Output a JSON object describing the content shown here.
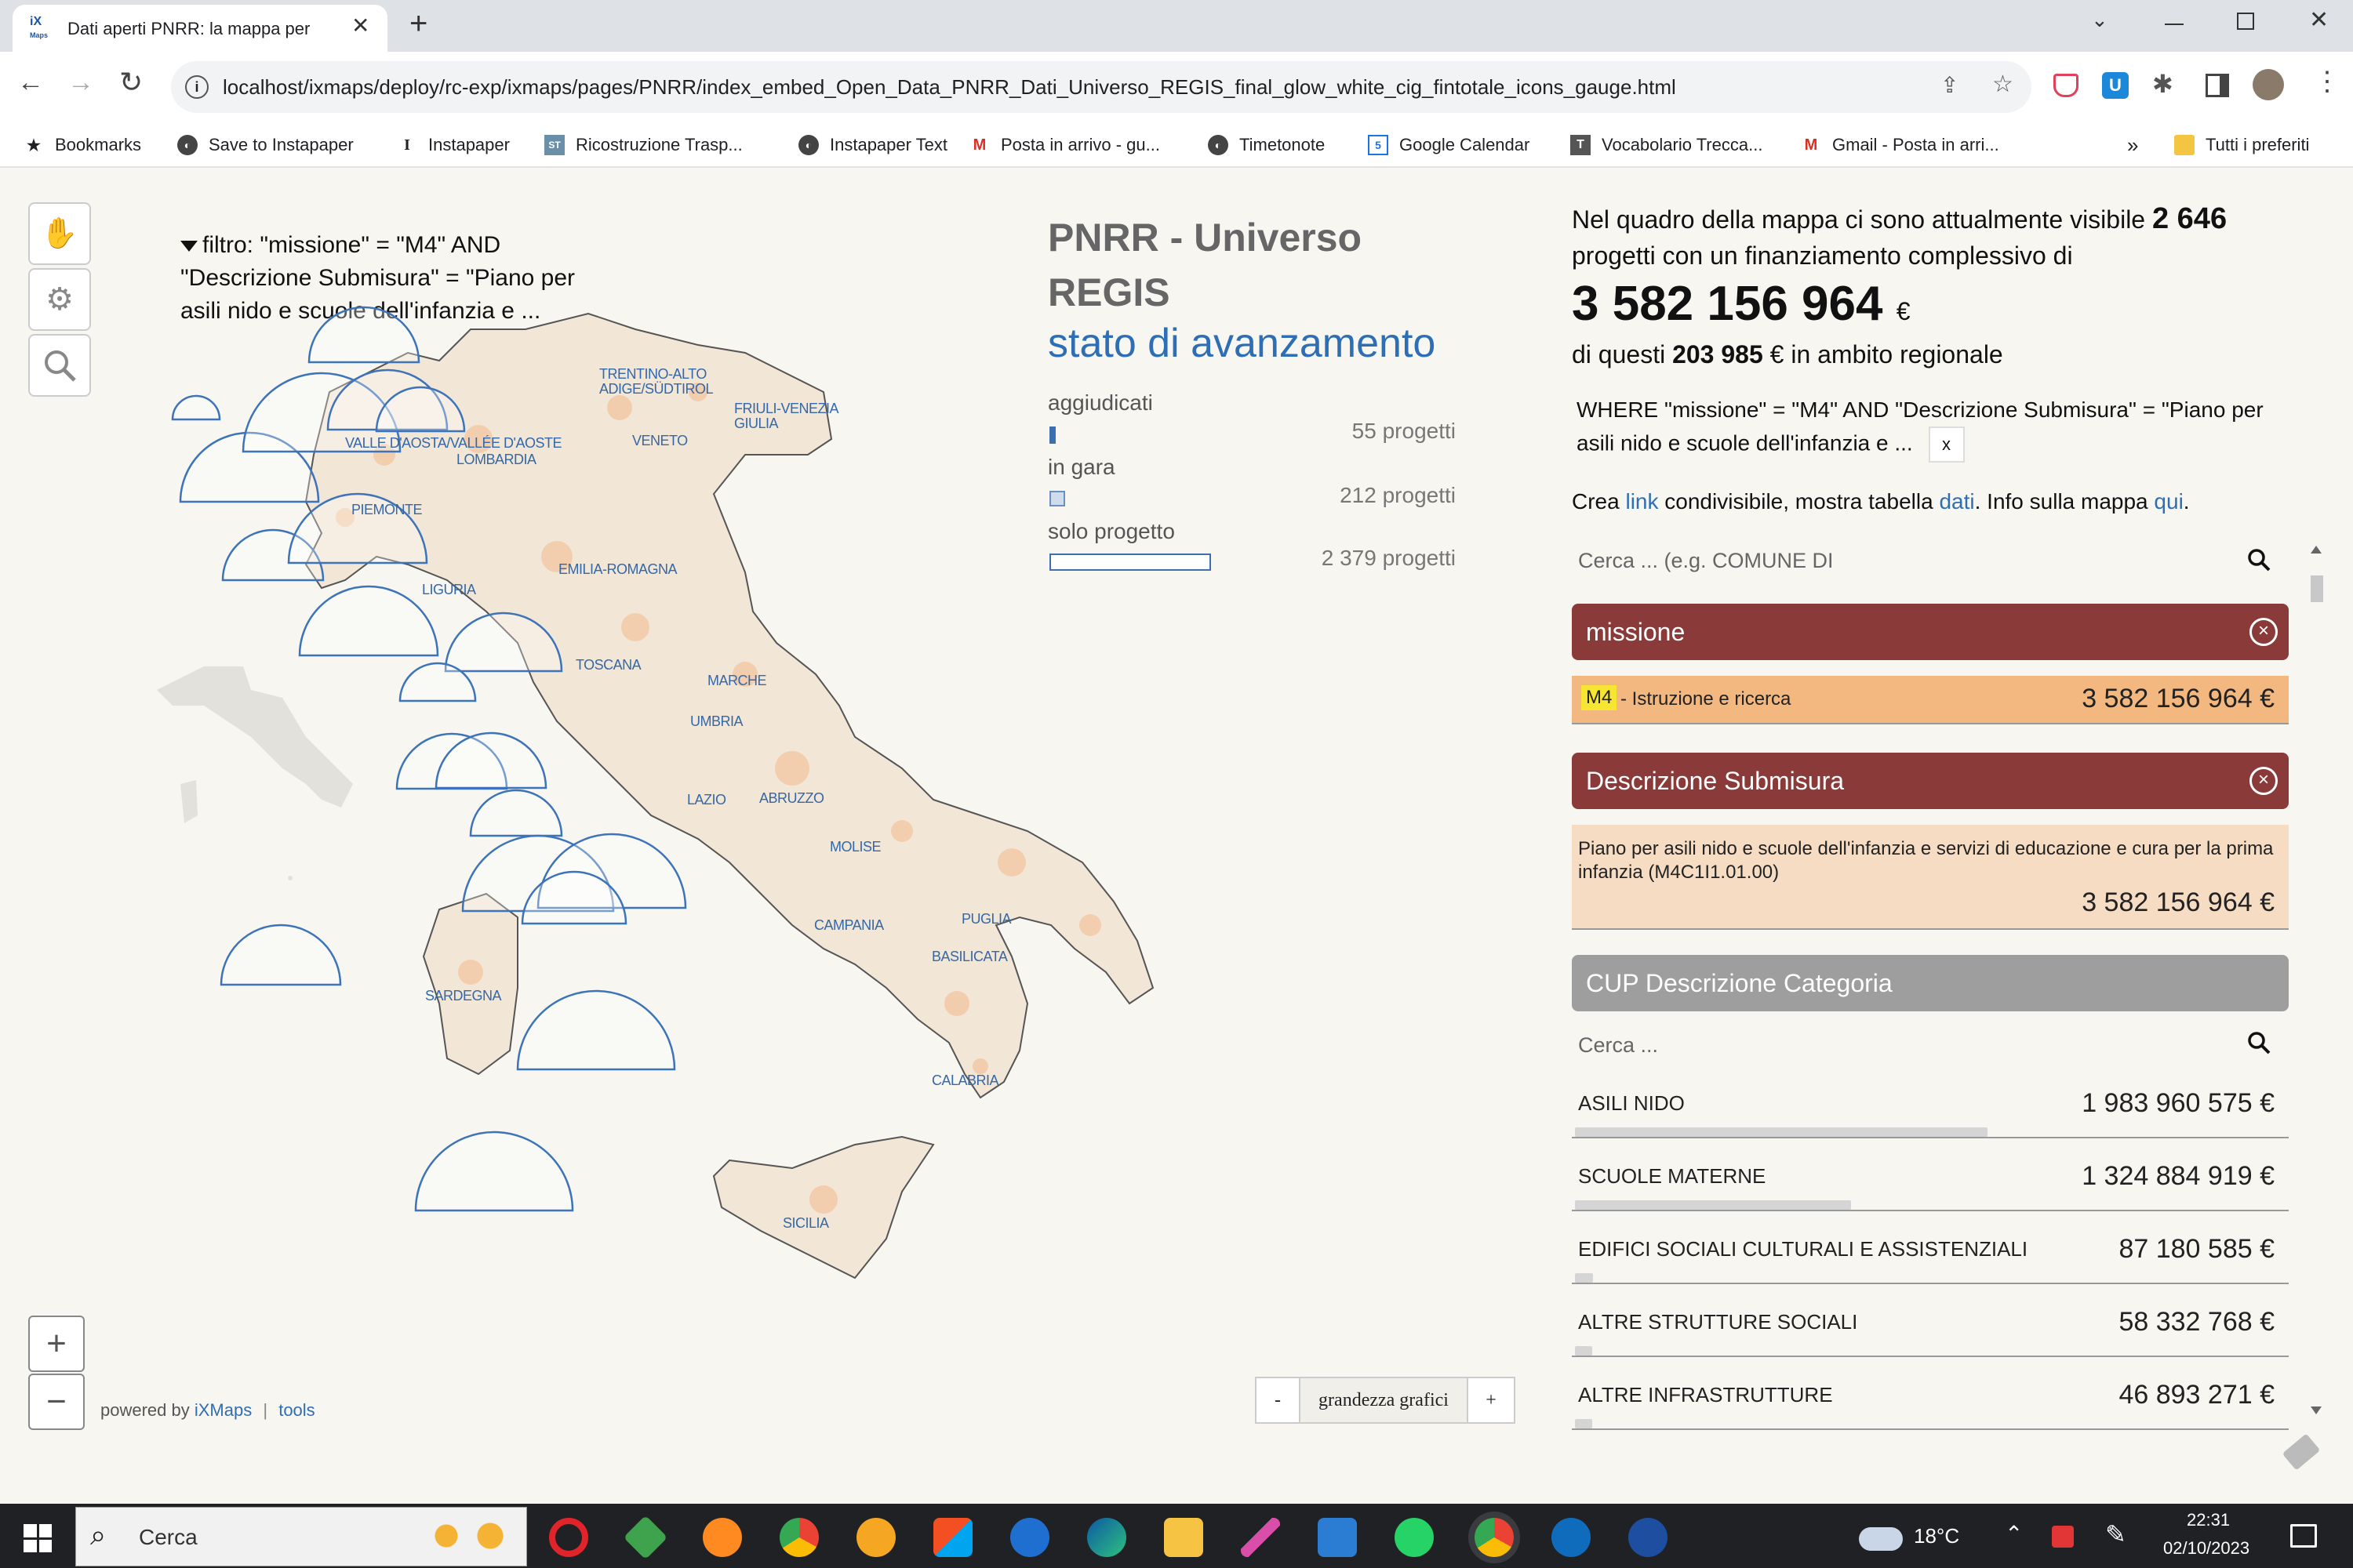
{
  "browser": {
    "tab_title": "Dati aperti PNRR: la mappa per",
    "url": "localhost/ixmaps/deploy/rc-exp/ixmaps/pages/PNRR/index_embed_Open_Data_PNRR_Dati_Universo_REGIS_final_glow_white_cig_fintotale_icons_gauge.html",
    "bookmarks": [
      "Bookmarks",
      "Save to Instapaper",
      "Instapaper",
      "Ricostruzione Trasp...",
      "Instapaper Text",
      "Posta in arrivo - gu...",
      "Timetonote",
      "Google Calendar",
      "Vocabolario Trecca...",
      "Gmail - Posta in arri...",
      "»",
      "Tutti i preferiti"
    ]
  },
  "map": {
    "filter_text": "filtro: \"missione\" = \"M4\" AND \"Descrizione Submisura\" = \"Piano per asili nido e scuole dell'infanzia e ...",
    "title_line1": "PNRR - Universo",
    "title_line2": "REGIS",
    "subtitle": "stato di avanzamento",
    "legend": [
      {
        "label": "aggiudicati",
        "value": "55 progetti"
      },
      {
        "label": "in gara",
        "value": "212 progetti"
      },
      {
        "label": "solo progetto",
        "value": "2 379 progetti"
      }
    ],
    "regions": [
      "VALLE D'AOSTA/VALLÉE D'AOSTE",
      "LOMBARDIA",
      "PIEMONTE",
      "TRENTINO-ALTO ADIGE/SÜDTIROL",
      "VENETO",
      "FRIULI-VENEZIA GIULIA",
      "LIGURIA",
      "EMILIA-ROMAGNA",
      "TOSCANA",
      "MARCHE",
      "UMBRIA",
      "LAZIO",
      "ABRUZZO",
      "MOLISE",
      "CAMPANIA",
      "PUGLIA",
      "BASILICATA",
      "SARDEGNA",
      "CALABRIA",
      "SICILIA"
    ],
    "powered_by": "powered by",
    "ixmaps": "iXMaps",
    "tools": "tools",
    "size_minus": "-",
    "size_label": "grandezza grafici",
    "size_plus": "+",
    "zoom_in": "+",
    "zoom_out": "−"
  },
  "summary": {
    "intro": "Nel quadro della mappa ci sono attualmente visibile",
    "count": "2 646",
    "intro2": "progetti con un finanziamento complessivo di",
    "total": "3 582 156 964",
    "currency": "€",
    "regional_pre": "di questi",
    "regional_value": "203 985",
    "regional_post": "€ in ambito regionale",
    "where": "WHERE \"missione\" = \"M4\" AND \"Descrizione Submisura\" = \"Piano per asili nido e scuole dell'infanzia e ...",
    "where_close": "x",
    "links_1": "Crea",
    "link_a": "link",
    "links_2": "condivisibile, mostra tabella",
    "link_b": "dati",
    "links_3": ". Info sulla mappa",
    "link_c": "qui",
    "links_4": "."
  },
  "filters": {
    "search_placeholder": "Cerca ... (e.g. COMUNE DI",
    "missione": {
      "title": "missione",
      "code": "M4",
      "label": " - Istruzione e ricerca",
      "value": "3 582 156 964 €"
    },
    "submisura": {
      "title": "Descrizione Submisura",
      "label": "Piano per asili nido e scuole dell'infanzia e servizi di educazione e cura per la prima infanzia (M4C1I1.01.00)",
      "value": "3 582 156 964 €"
    },
    "cup": {
      "title": "CUP Descrizione Categoria",
      "search_placeholder": "Cerca ...",
      "items": [
        {
          "name": "ASILI NIDO",
          "value": "1 983 960 575 €",
          "share": 0.554
        },
        {
          "name": "SCUOLE MATERNE",
          "value": "1 324 884 919 €",
          "share": 0.37
        },
        {
          "name": "EDIFICI SOCIALI CULTURALI E ASSISTENZIALI",
          "value": "87 180 585 €",
          "share": 0.024
        },
        {
          "name": "ALTRE STRUTTURE SOCIALI",
          "value": "58 332 768 €",
          "share": 0.016
        },
        {
          "name": "ALTRE INFRASTRUTTURE",
          "value": "46 893 271 €",
          "share": 0.013
        }
      ]
    }
  },
  "taskbar": {
    "search": "Cerca",
    "temperature": "18°C",
    "time": "22:31",
    "date": "02/10/2023"
  },
  "colors": {
    "accent": "#3468a8",
    "panel_head": "#8b3a3a",
    "panel_gray": "#9e9e9e",
    "orange": "#f3b87f",
    "peach": "#f5dcc3"
  }
}
